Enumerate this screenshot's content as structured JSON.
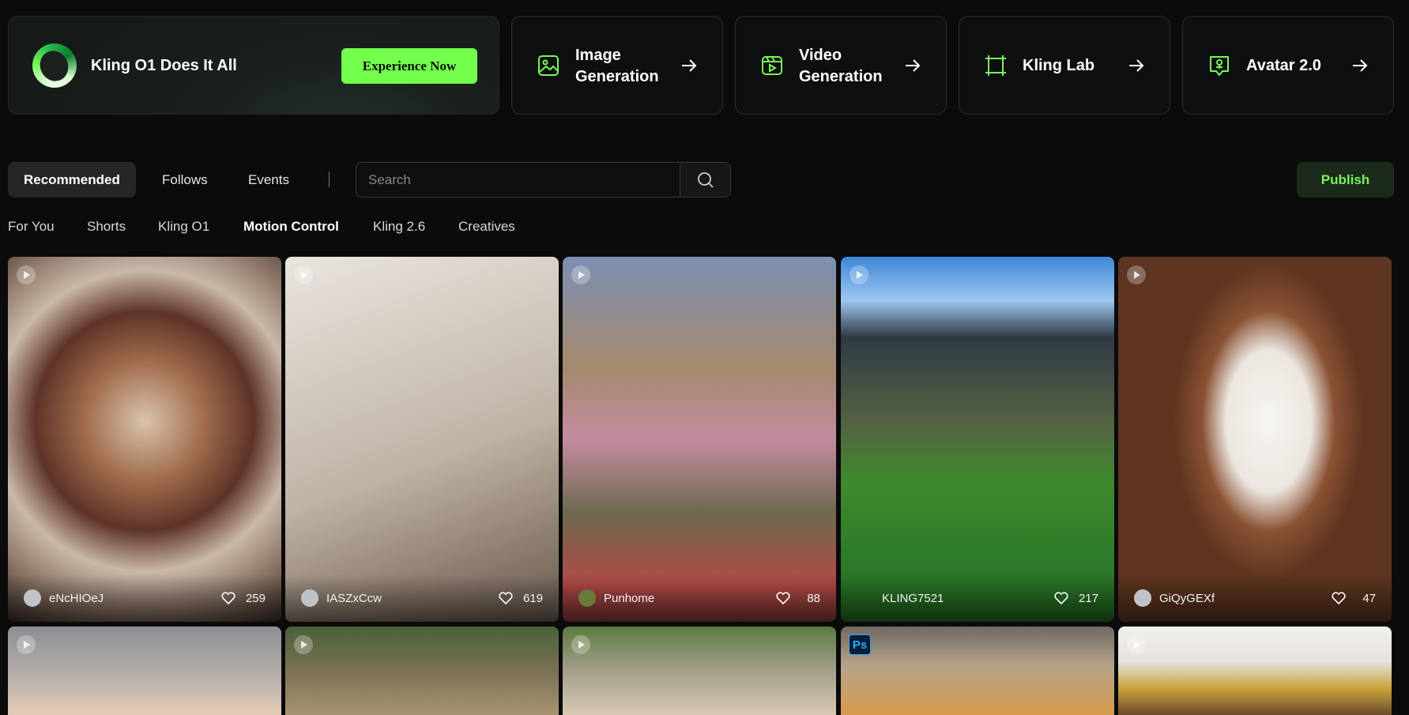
{
  "hero": {
    "title": "Kling O1 Does It All",
    "cta": "Experience Now"
  },
  "feature_cards": [
    {
      "label_line1": "Image",
      "label_line2": "Generation",
      "icon": "image-icon"
    },
    {
      "label_line1": "Video",
      "label_line2": "Generation",
      "icon": "video-icon"
    },
    {
      "label": "Kling Lab",
      "icon": "crop-frame-icon"
    },
    {
      "label": "Avatar 2.0",
      "icon": "avatar-icon"
    }
  ],
  "tabs": [
    "Recommended",
    "Follows",
    "Events"
  ],
  "divider": "|",
  "search": {
    "placeholder": "Search"
  },
  "publish_label": "Publish",
  "subtabs": [
    "For You",
    "Shorts",
    "Kling O1",
    "Motion Control",
    "Kling 2.6",
    "Creatives"
  ],
  "active_subtab": "Motion Control",
  "colors": {
    "accent": "#74ff4d",
    "background": "#0b0b0c"
  },
  "feed": [
    {
      "user": "eNcHIOeJ",
      "likes": "259",
      "desc": "shih tzu in santa costume"
    },
    {
      "user": "IASZxCcw",
      "likes": "619",
      "desc": "bichon in puffer suit"
    },
    {
      "user": "Punhome",
      "likes": "88",
      "desc": "dog in traditional costume"
    },
    {
      "user": "KLING7521",
      "likes": "217",
      "desc": "soccer player in stadium"
    },
    {
      "user": "GiQyGEXf",
      "likes": "47",
      "desc": "white pomeranian"
    }
  ],
  "ps_badge": "Ps"
}
